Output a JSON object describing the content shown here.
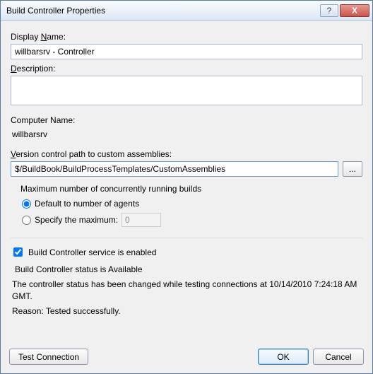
{
  "titlebar": {
    "title": "Build Controller Properties",
    "help": "?",
    "close": "X"
  },
  "labels": {
    "displayName_pre": "Display ",
    "displayName_u": "N",
    "displayName_post": "ame:",
    "description_u": "D",
    "description_post": "escription:",
    "computerName": "Computer Name:",
    "vcp_u": "V",
    "vcp_post": "ersion control path to custom assemblies:",
    "browse": "...",
    "maxBuilds": "Maximum number of concurrently running builds",
    "radioDefault": "Default to number of agents",
    "radioSpecify_pre": "Specify the ",
    "radioSpecify_u": "m",
    "radioSpecify_post": "aximum:",
    "enabled": "Build Controller service is enabled",
    "statusLabel": "Build Controller status is Available",
    "statusMsg1": "The controller status has been changed while testing connections at 10/14/2010 7:24:18 AM GMT.",
    "statusMsg2": "Reason: Tested successfully."
  },
  "fields": {
    "displayName": "willbarsrv - Controller",
    "description": "",
    "computerName": "willbarsrv",
    "vcpath": "$/BuildBook/BuildProcessTemplates/CustomAssemblies",
    "maxValue": "0",
    "radio": "default",
    "enabled": true
  },
  "buttons": {
    "test_u": "T",
    "test_post": "est Connection",
    "ok": "OK",
    "cancel": "Cancel"
  }
}
